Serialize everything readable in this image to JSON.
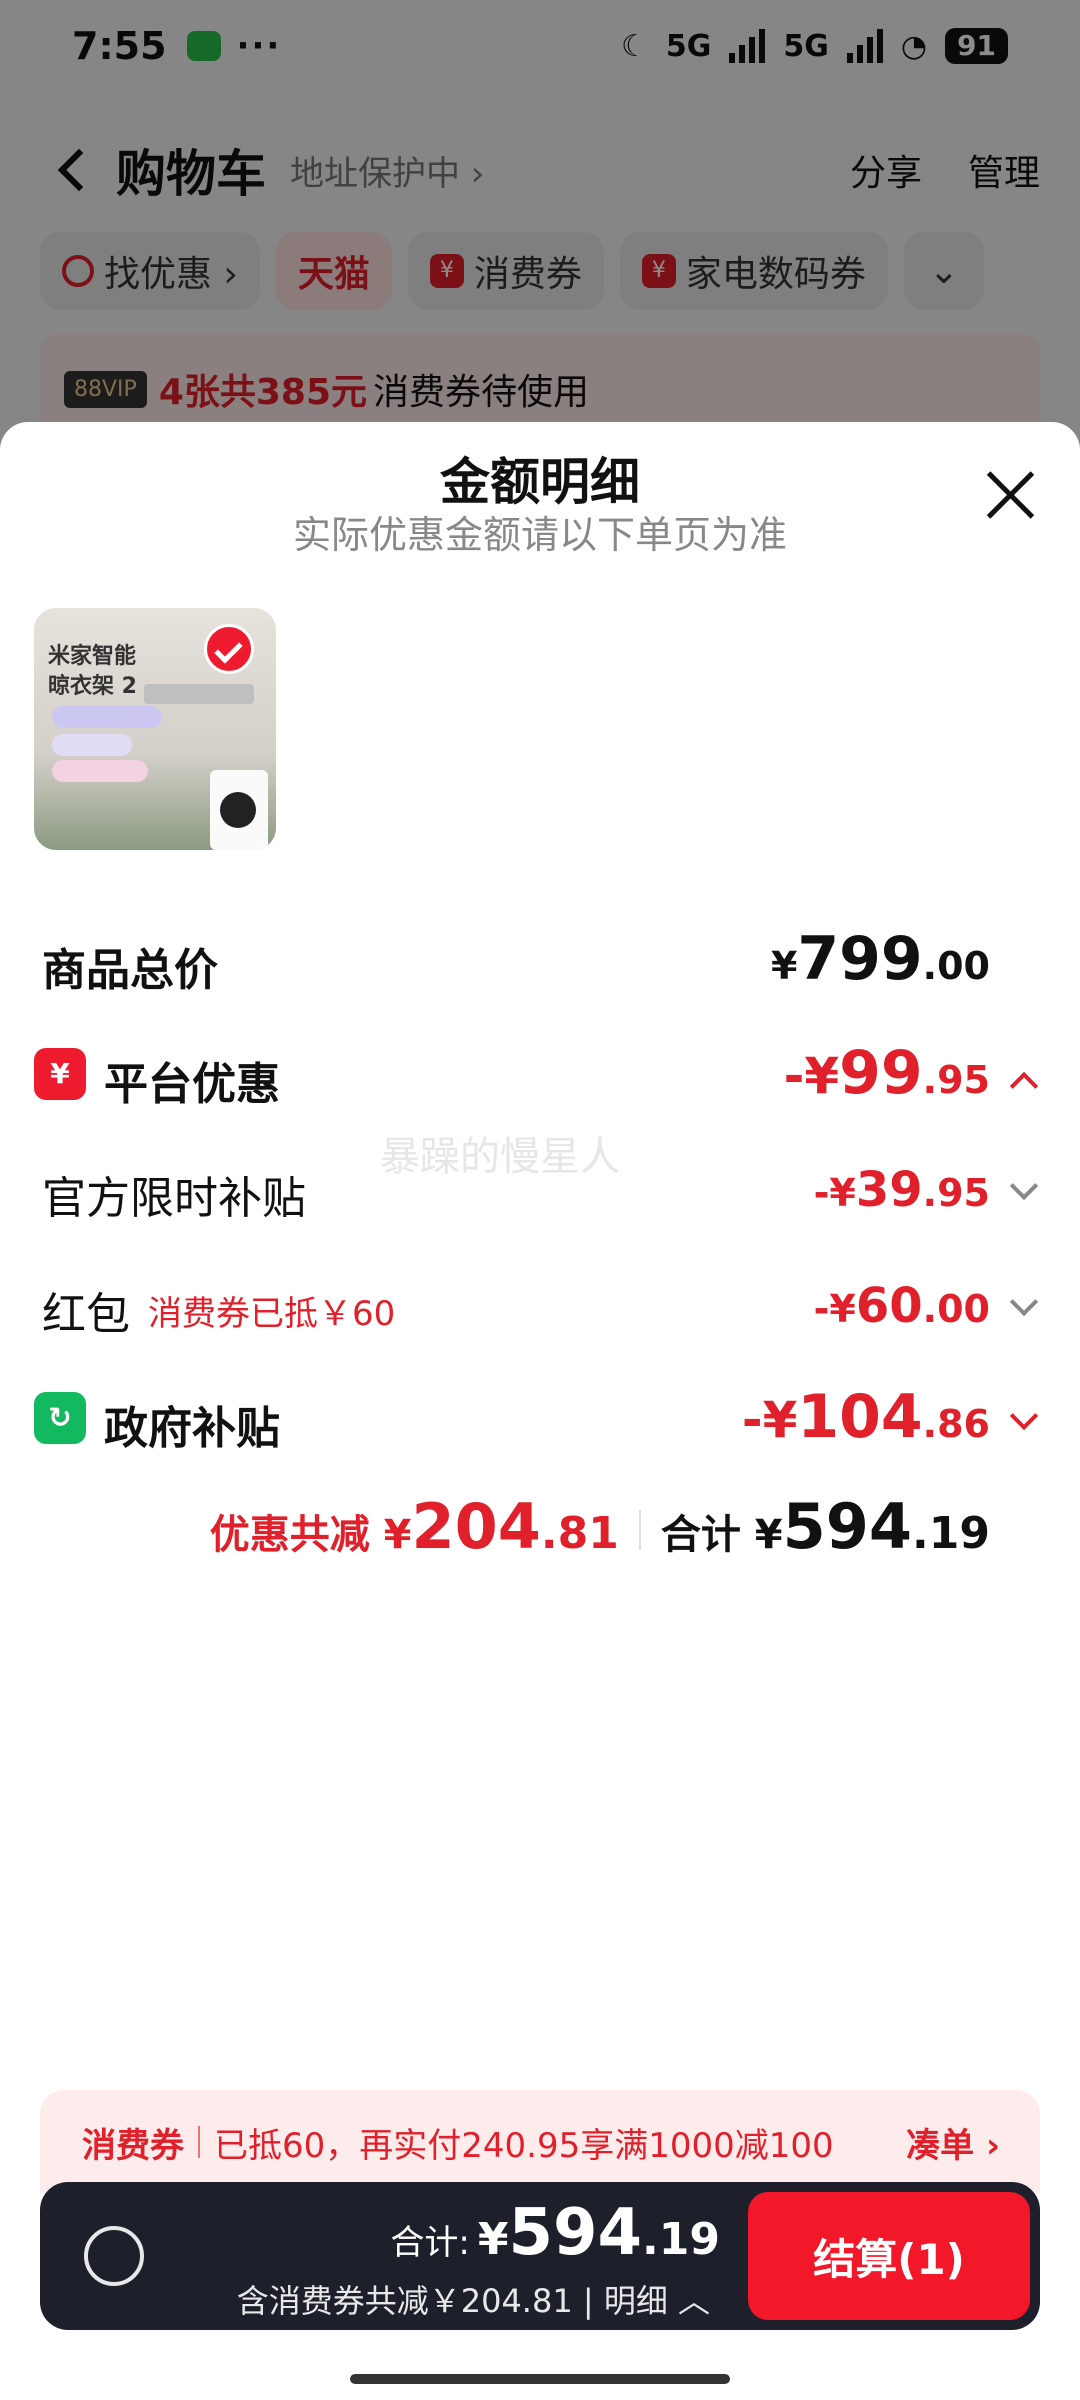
{
  "status_bar": {
    "time": "7:55",
    "battery": "91",
    "network": "5G"
  },
  "header": {
    "title": "购物车",
    "address": "地址保护中 ›",
    "share": "分享",
    "manage": "管理"
  },
  "chips": [
    {
      "label": "找优惠 ›"
    },
    {
      "label": "天猫"
    },
    {
      "label": "消费券"
    },
    {
      "label": "家电数码券"
    }
  ],
  "vip_bar": {
    "badge": "88VIP",
    "count": "4张共385元",
    "text": "消费券待使用"
  },
  "sheet": {
    "title": "金额明细",
    "subtitle": "实际优惠金额请以下单页为准",
    "product": {
      "image_line1": "米家智能",
      "image_line2": "晾衣架 2"
    },
    "rows": {
      "total_price": {
        "label": "商品总价",
        "currency": "¥",
        "int": "799",
        "dec": ".00"
      },
      "platform": {
        "label": "平台优惠",
        "icon": "¥",
        "prefix": "-¥",
        "int": "99",
        "dec": ".95"
      },
      "official": {
        "label": "官方限时补贴",
        "prefix": "-¥",
        "int": "39",
        "dec": ".95"
      },
      "hongbao": {
        "label": "红包",
        "note": "消费券已抵￥60",
        "prefix": "-¥",
        "int": "60",
        "dec": ".00"
      },
      "gov": {
        "label": "政府补贴",
        "prefix": "-¥",
        "int": "104",
        "dec": ".86"
      }
    },
    "watermark": "暴躁的慢星人",
    "summary": {
      "discount_label": "优惠共减 ¥",
      "discount_int": "204",
      "discount_dec": ".81",
      "total_label": "合计 ¥",
      "total_int": "594",
      "total_dec": ".19"
    }
  },
  "promo": {
    "tag": "消费券",
    "text": "已抵60，再实付240.95享满1000减100",
    "more": "凑单 ›"
  },
  "checkout": {
    "total_label": "合计:",
    "currency": "¥",
    "int": "594",
    "dec": ".19",
    "sub": "含消费券共减￥204.81 | 明细 ︿",
    "button": "结算(1)"
  }
}
